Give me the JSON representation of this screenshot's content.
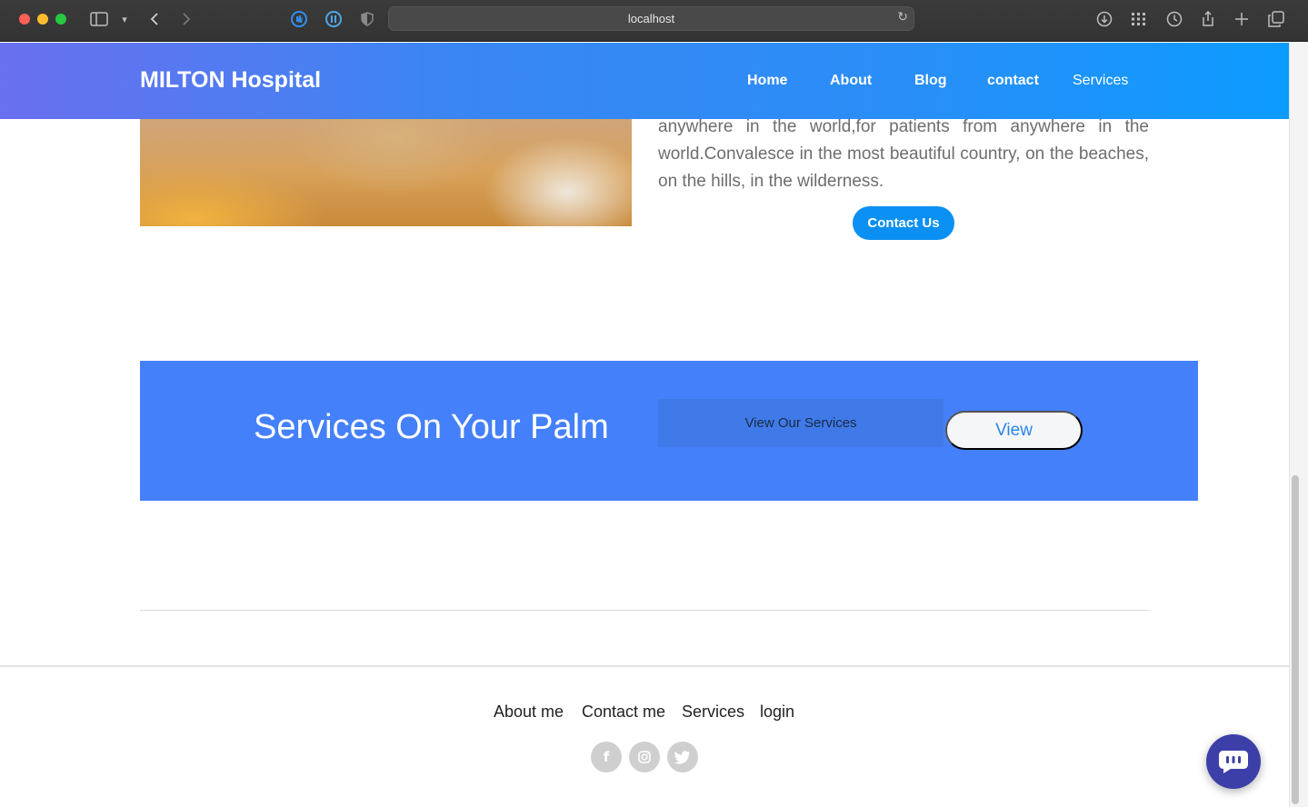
{
  "browser": {
    "url": "localhost"
  },
  "header": {
    "brand": "MILTON Hospital",
    "nav": {
      "home": "Home",
      "about": "About",
      "blog": "Blog",
      "contact": "contact",
      "services": "Services"
    }
  },
  "hero": {
    "text": "anywhere in the world,for patients from anywhere in the world.Convalesce in the most beautiful country, on the beaches, on the hills, in the wilderness.",
    "contact_button": "Contact Us"
  },
  "services_banner": {
    "title": "Services On Your Palm",
    "view_services_label": "View Our Services",
    "view_button": "View",
    "color": "#4480fa"
  },
  "footer": {
    "links": {
      "about": "About me",
      "contact": "Contact me",
      "services": "Services",
      "login": "login"
    },
    "social": {
      "facebook": "f",
      "instagram": "instagram-icon",
      "twitter": "twitter-icon"
    }
  },
  "colors": {
    "accent": "#0a90f2",
    "chat": "#3d3fa8"
  }
}
